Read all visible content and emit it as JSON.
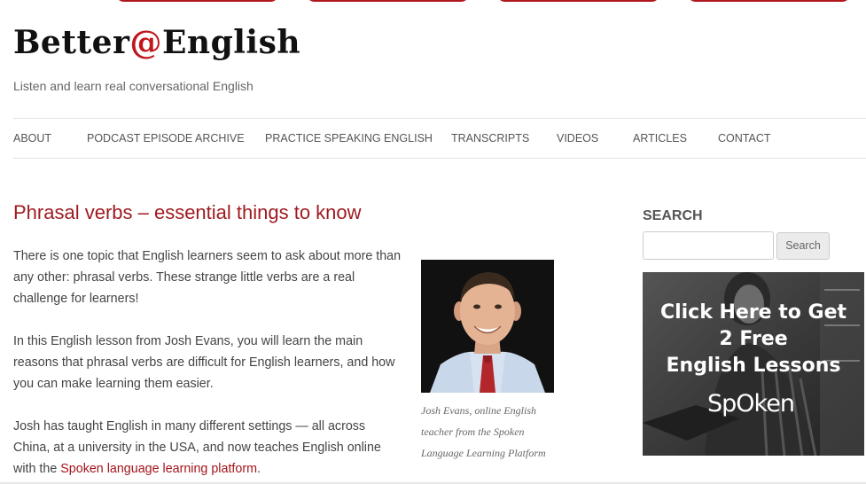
{
  "site": {
    "brand_before": "Better",
    "brand_at": "@",
    "brand_after": "English",
    "tagline": "Listen and learn real conversational English"
  },
  "nav": {
    "items": [
      {
        "label": "ABOUT"
      },
      {
        "label": "PODCAST EPISODE ARCHIVE"
      },
      {
        "label": "PRACTICE SPEAKING ENGLISH"
      },
      {
        "label": "TRANSCRIPTS"
      },
      {
        "label": "VIDEOS"
      },
      {
        "label": "ARTICLES"
      },
      {
        "label": "CONTACT"
      }
    ]
  },
  "post": {
    "title": "Phrasal verbs – essential things to know",
    "paragraphs": [
      "There is one topic that English learners seem to ask about more than any other: phrasal verbs. These strange little verbs are a real challenge for learners!",
      "In this English lesson from Josh Evans, you will learn the main reasons that phrasal verbs are difficult for English learners, and how you can make learning them easier.",
      "Josh has taught English in many different settings — all across China, at a university in the USA, and now teaches English online with the "
    ],
    "link_text": "Spoken language learning platform",
    "after_link": ".",
    "caption": "Josh Evans, online English teacher from the Spoken Language Learning Platform"
  },
  "sidebar": {
    "search_title": "SEARCH",
    "search_value": "",
    "search_button": "Search",
    "ad": {
      "line1": "Click Here to Get",
      "line2": "2 Free",
      "line3": "English Lessons",
      "logo": "SpOken"
    }
  },
  "colors": {
    "accent": "#9e1a1f",
    "link": "#a3151b",
    "tab_border": "#b0181e"
  },
  "icons": {
    "top_tabs": "decorative-tab-shapes"
  }
}
